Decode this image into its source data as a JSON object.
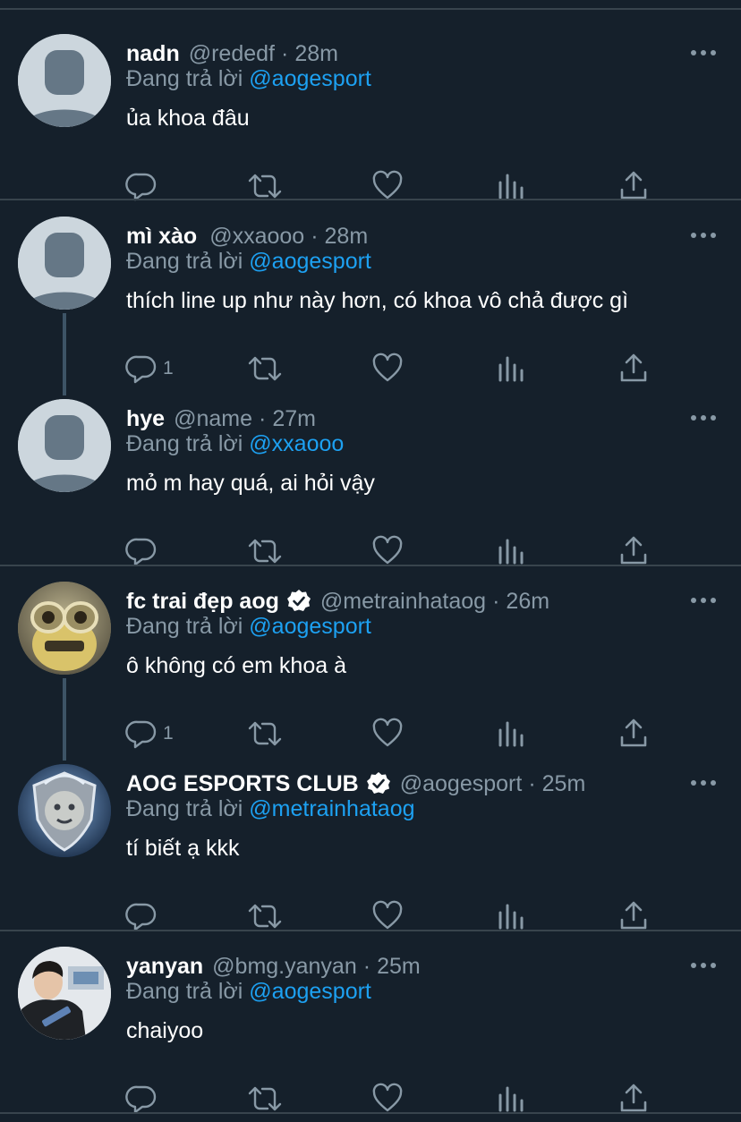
{
  "tweets": [
    {
      "name": "nadn",
      "handle": "@rededf",
      "time": "28m",
      "reply_prefix": "Đang trả lời",
      "reply_to": "@aogesport",
      "text": "ủa khoa đâu",
      "verified": false,
      "reply_count": "",
      "avatar": "default-avatar"
    },
    {
      "name": "mì xào",
      "handle": "@xxaooo",
      "time": "28m",
      "reply_prefix": "Đang trả lời",
      "reply_to": "@aogesport",
      "text": "thích line up như này hơn, có khoa vô chả được gì",
      "verified": false,
      "reply_count": "1",
      "avatar": "default-avatar"
    },
    {
      "name": "hye",
      "handle": "@name",
      "time": "27m",
      "reply_prefix": "Đang trả lời",
      "reply_to": "@xxaooo",
      "text": "mỏ m hay quá, ai hỏi vậy",
      "verified": false,
      "reply_count": "",
      "avatar": "default-avatar"
    },
    {
      "name": "fc trai đẹp aog",
      "handle": "@metrainhataog",
      "time": "26m",
      "reply_prefix": "Đang trả lời",
      "reply_to": "@aogesport",
      "text": "ô không có em khoa à",
      "verified": true,
      "reply_count": "1",
      "avatar": "minion-avatar"
    },
    {
      "name": "AOG ESPORTS CLUB",
      "handle": "@aogesport",
      "time": "25m",
      "reply_prefix": "Đang trả lời",
      "reply_to": "@metrainhataog",
      "text": "tí biết ạ kkk",
      "verified": true,
      "reply_count": "",
      "avatar": "lion-crest-avatar"
    },
    {
      "name": "yanyan",
      "handle": "@bmg.yanyan",
      "time": "25m",
      "reply_prefix": "Đang trả lời",
      "reply_to": "@aogesport",
      "text": "chaiyoo",
      "verified": false,
      "reply_count": "",
      "avatar": "photo-avatar"
    }
  ],
  "separator": "·",
  "colors": {
    "background": "#15202b",
    "divider": "#38444d",
    "muted": "#8899a6",
    "link": "#1da1f2",
    "text": "#ffffff"
  }
}
